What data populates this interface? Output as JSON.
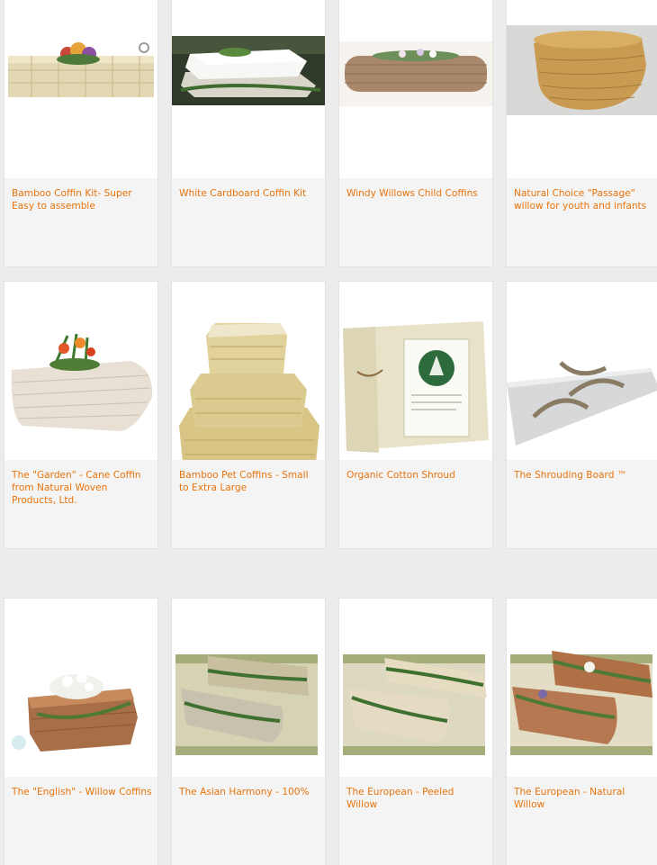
{
  "products": [
    {
      "title": "Bamboo Coffin Kit- Super Easy to assemble",
      "image": "bamboo-coffin-kit-image"
    },
    {
      "title": "White Cardboard Coffin Kit",
      "image": "white-cardboard-coffin-image"
    },
    {
      "title": "Windy Willows Child Coffins",
      "image": "willow-child-coffin-image"
    },
    {
      "title": "Natural Choice \"Passage\" willow for youth and infants",
      "image": "passage-willow-basket-image"
    },
    {
      "title": "The \"Garden\" - Cane Coffin from Natural Woven Products, Ltd.",
      "image": "garden-cane-coffin-image"
    },
    {
      "title": "Bamboo Pet Coffins - Small to Extra Large",
      "image": "bamboo-pet-coffins-image"
    },
    {
      "title": "Organic Cotton Shroud",
      "image": "organic-cotton-shroud-image"
    },
    {
      "title": "The Shrouding Board ™",
      "image": "shrouding-board-image"
    },
    {
      "title": "The \"English\" - Willow Coffins",
      "image": "english-willow-coffin-image"
    },
    {
      "title": "The Asian Harmony - 100%",
      "image": "asian-harmony-coffins-image"
    },
    {
      "title": "The European - Peeled Willow",
      "image": "european-peeled-willow-image"
    },
    {
      "title": "The European - Natural Willow",
      "image": "european-natural-willow-image"
    }
  ]
}
